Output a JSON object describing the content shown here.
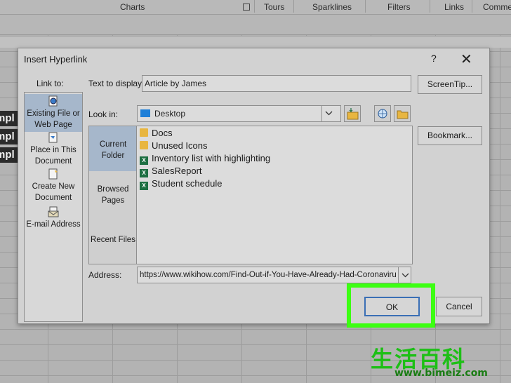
{
  "ribbon": {
    "groups": [
      "Charts",
      "Tours",
      "Sparklines",
      "Filters",
      "Links",
      "Comme"
    ]
  },
  "sheet": {
    "cell_fragment": "mpl"
  },
  "dialog": {
    "title": "Insert Hyperlink",
    "help_label": "?",
    "close_label": "✕",
    "link_to_label": "Link to:",
    "link_to_items": [
      {
        "line1": "Existing File or",
        "line2": "Web Page",
        "icon": "existing-file-icon"
      },
      {
        "line1": "Place in This",
        "line2": "Document",
        "icon": "place-in-document-icon"
      },
      {
        "line1": "Create New",
        "line2": "Document",
        "icon": "new-document-icon"
      },
      {
        "line1": "E-mail Address",
        "line2": "",
        "icon": "email-icon"
      }
    ],
    "text_to_display_label": "Text to display:",
    "text_to_display_value": "Article by James",
    "screentip_label": "ScreenTip...",
    "look_in_label": "Look in:",
    "look_in_value": "Desktop",
    "bookmark_label": "Bookmark...",
    "places": [
      {
        "line1": "Current",
        "line2": "Folder"
      },
      {
        "line1": "Browsed",
        "line2": "Pages"
      },
      {
        "line1": "Recent Files",
        "line2": ""
      }
    ],
    "files": [
      {
        "name": "Docs",
        "type": "folder"
      },
      {
        "name": "Unused Icons",
        "type": "folder"
      },
      {
        "name": "Inventory list with highlighting",
        "type": "excel"
      },
      {
        "name": "SalesReport",
        "type": "excel"
      },
      {
        "name": "Student schedule",
        "type": "excel"
      }
    ],
    "address_label": "Address:",
    "address_value": "https://www.wikihow.com/Find-Out-if-You-Have-Already-Had-Coronavirus",
    "ok_label": "OK",
    "cancel_label": "Cancel"
  },
  "watermark": {
    "chars": "生活百科",
    "url": "www.bimeiz.com"
  },
  "colors": {
    "highlight": "#3cff12",
    "selection": "#a6b7cb",
    "excel_icon": "#1d6f42",
    "folder_icon": "#e8b640"
  }
}
